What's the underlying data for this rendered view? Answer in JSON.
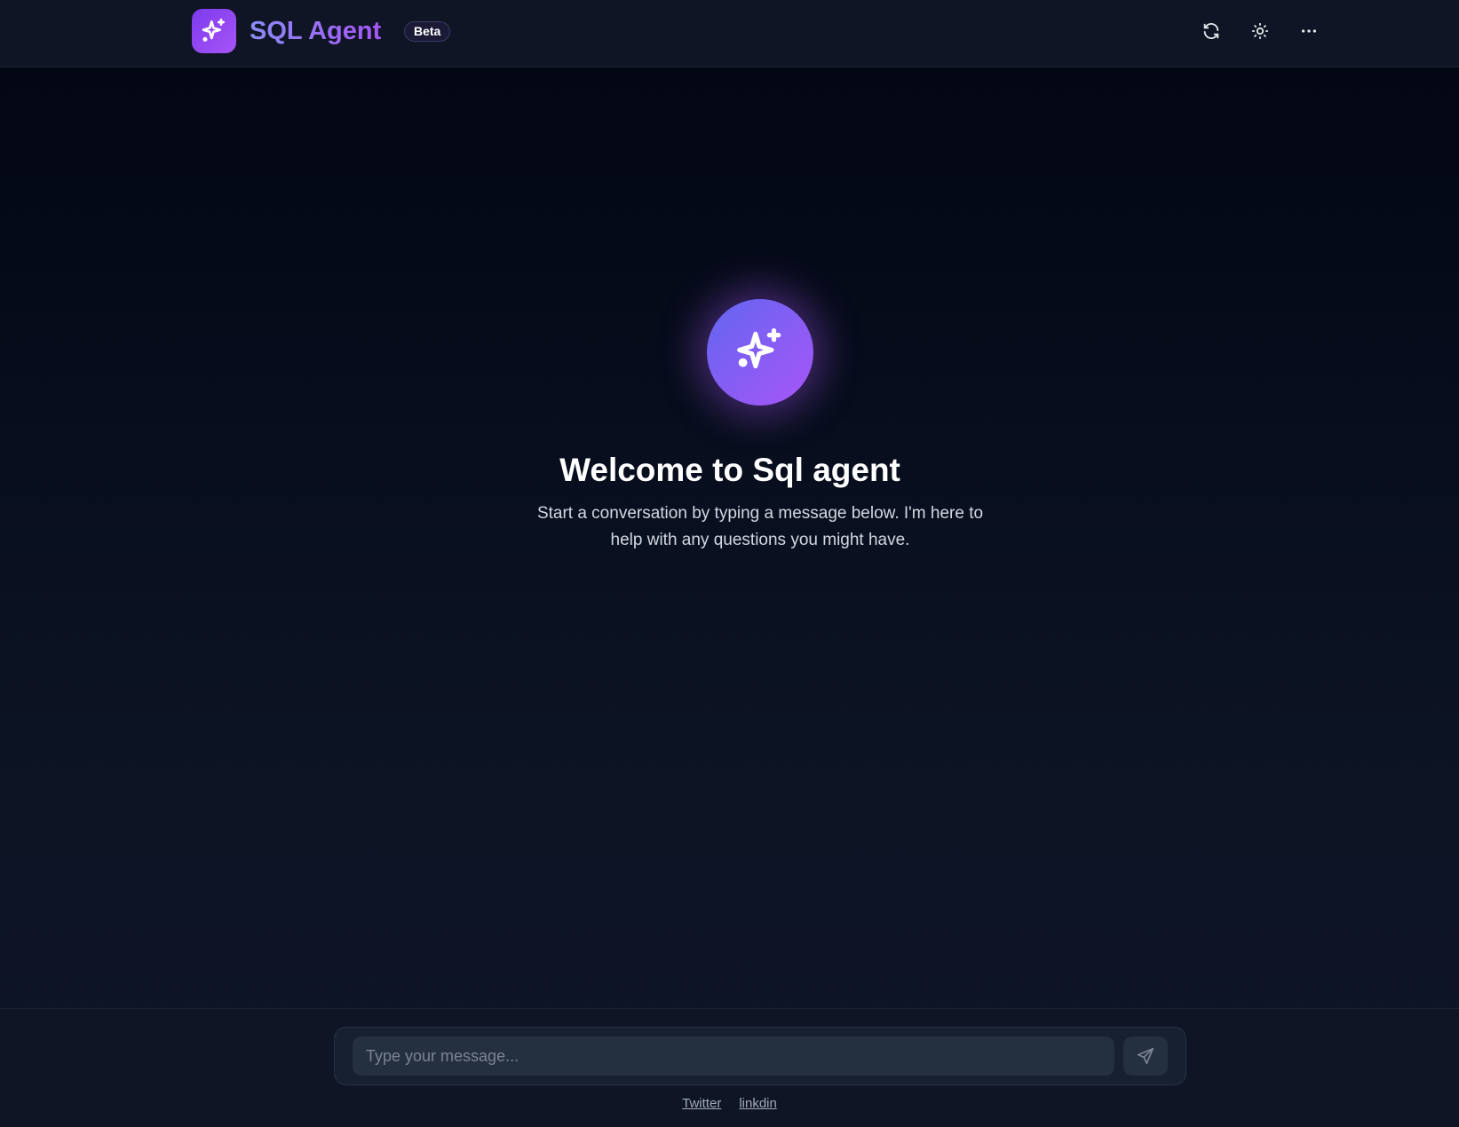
{
  "header": {
    "logo_icon": "sparkles-icon",
    "title": "SQL Agent",
    "badge": "Beta",
    "actions": [
      {
        "icon": "refresh-icon"
      },
      {
        "icon": "sun-icon"
      },
      {
        "icon": "more-horizontal-icon"
      }
    ]
  },
  "welcome": {
    "icon": "sparkles-icon",
    "title": "Welcome to Sql agent",
    "subtitle": "Start a conversation by typing a message below. I'm here to help with any questions you might have."
  },
  "composer": {
    "placeholder": "Type your message...",
    "value": "",
    "send_icon": "send-icon"
  },
  "footer": {
    "links": [
      "Twitter",
      "linkdin"
    ]
  },
  "colors": {
    "accent_start": "#6366f1",
    "accent_end": "#a855f7",
    "header_bg": "#0f1524",
    "input_bg": "#242f3f"
  }
}
